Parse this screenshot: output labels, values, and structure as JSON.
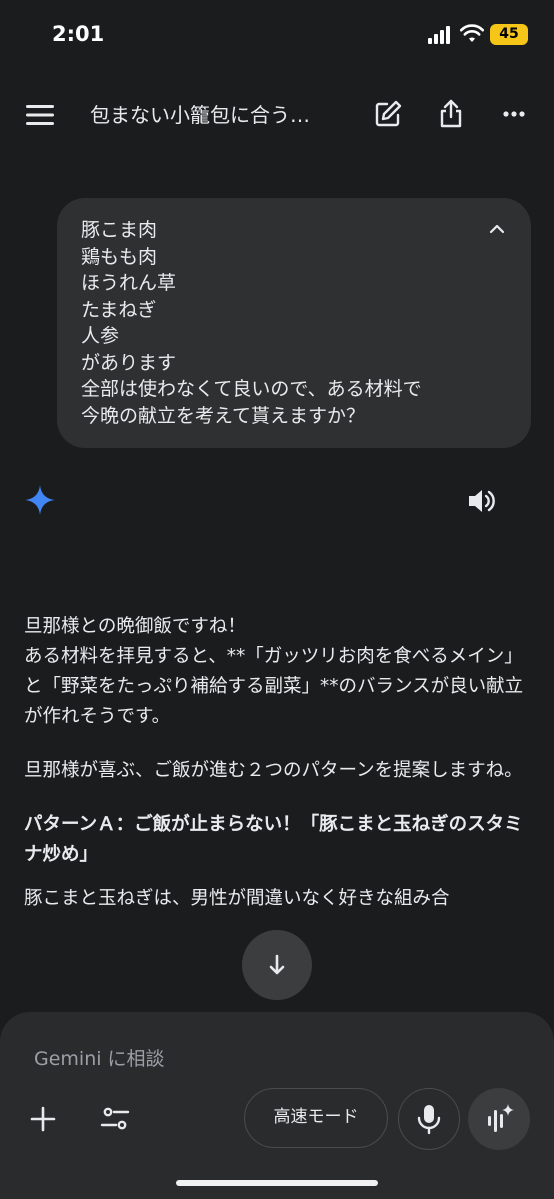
{
  "status": {
    "time": "2:01",
    "battery": "45"
  },
  "header": {
    "title": "包まない小籠包に合う…"
  },
  "user_message": {
    "lines": [
      "豚こま肉",
      "鶏もも肉",
      "ほうれん草",
      "たまねぎ",
      "人参",
      "があります",
      "全部は使わなくて良いので、ある材料で",
      "今晩の献立を考えて貰えますか？"
    ]
  },
  "response": {
    "paragraphs": [
      "旦那様との晩御飯ですね！\nある材料を拝見すると、**「ガッツリお肉を食べるメイン」と「野菜をたっぷり補給する副菜」**のバランスが良い献立が作れそうです。",
      "旦那様が喜ぶ、ご飯が進む２つのパターンを提案しますね。",
      "パターンＡ：ご飯が止まらない！「豚こまと玉ねぎのスタミナ炒め」",
      "豚こまと玉ねぎは、男性が間違いなく好きな組み合"
    ]
  },
  "composer": {
    "placeholder": "Gemini に相談",
    "mode_label": "高速モード"
  },
  "colors": {
    "background": "#1b1c1d",
    "bubble": "#2f3031",
    "composer": "#2a2b2d",
    "spark_blue": "#4285f4",
    "battery": "#f5c518"
  }
}
